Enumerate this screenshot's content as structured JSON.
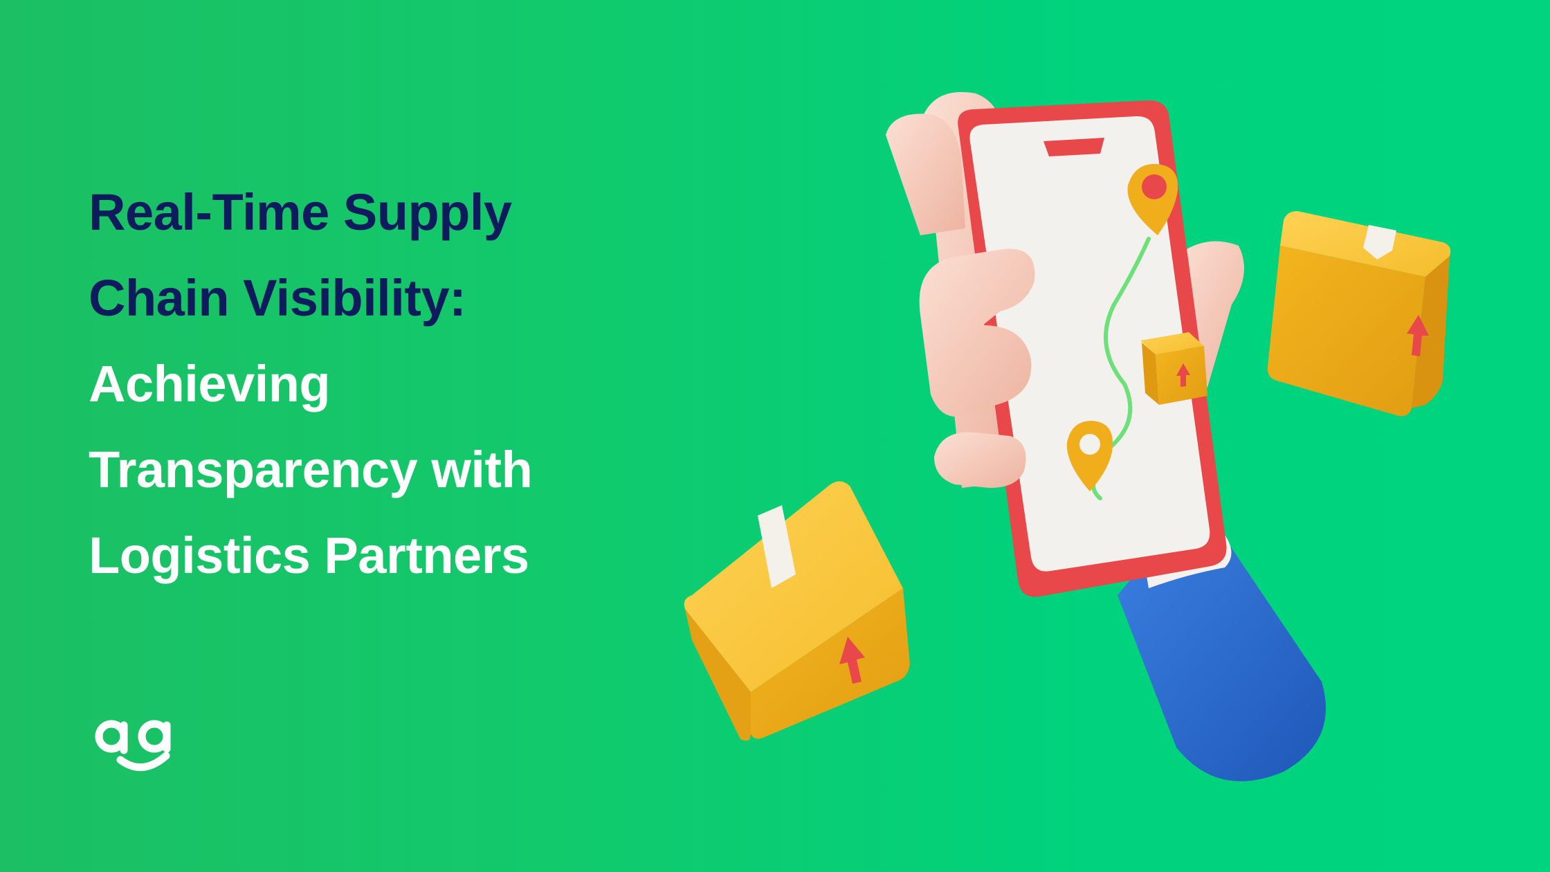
{
  "headline": {
    "line1": "Real-Time Supply",
    "line2": "Chain Visibility:",
    "line3": "Achieving",
    "line4": "Transparency with",
    "line5": "Logistics Partners"
  },
  "brand": {
    "logo_text": "ag",
    "logo_color": "#ffffff"
  },
  "colors": {
    "background": "#00d27d",
    "headline_dark": "#0e1b5c",
    "headline_light": "#ffffff",
    "phone_case": "#e8484a",
    "box": "#f2b822",
    "sleeve": "#2f6fd0",
    "hand": "#f6cbbb",
    "pin": "#f0ae1c",
    "route": "#6ee07a"
  },
  "icons": [
    "smartphone-icon",
    "hand-icon",
    "location-pin-icon",
    "package-box-icon",
    "up-arrow-icon"
  ]
}
